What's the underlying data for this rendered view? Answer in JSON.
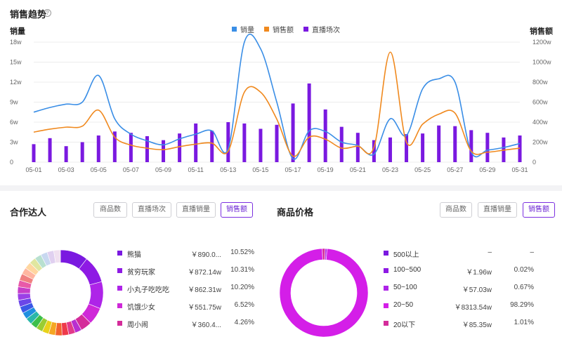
{
  "trend": {
    "title": "销售趋势",
    "help_icon": "?",
    "left_axis_title": "销量",
    "right_axis_title": "销售额",
    "legend": [
      {
        "name": "销量",
        "color": "#3a8ee6"
      },
      {
        "name": "销售额",
        "color": "#f0891e"
      },
      {
        "name": "直播场次",
        "color": "#7a19e0"
      }
    ]
  },
  "chart_data": {
    "type": "line",
    "x": [
      "05-01",
      "05-02",
      "05-03",
      "05-04",
      "05-05",
      "05-06",
      "05-07",
      "05-08",
      "05-09",
      "05-10",
      "05-11",
      "05-12",
      "05-13",
      "05-14",
      "05-15",
      "05-16",
      "05-17",
      "05-18",
      "05-19",
      "05-20",
      "05-21",
      "05-22",
      "05-23",
      "05-24",
      "05-25",
      "05-26",
      "05-27",
      "05-28",
      "05-29",
      "05-30",
      "05-31"
    ],
    "x_tick_labels": [
      "05-01",
      "05-03",
      "05-05",
      "05-07",
      "05-09",
      "05-11",
      "05-13",
      "05-15",
      "05-17",
      "05-19",
      "05-21",
      "05-23",
      "05-25",
      "05-27",
      "05-29",
      "05-31"
    ],
    "left_axis": {
      "ticks": [
        "0",
        "3w",
        "6w",
        "9w",
        "12w",
        "15w",
        "18w"
      ],
      "range": [
        0,
        18
      ]
    },
    "right_axis": {
      "ticks": [
        "0",
        "200w",
        "400w",
        "600w",
        "800w",
        "1000w",
        "1200w"
      ],
      "range": [
        0,
        1200
      ]
    },
    "series": [
      {
        "name": "销量",
        "axis": "left",
        "color": "#3a8ee6",
        "values": [
          7.5,
          8.2,
          8.7,
          9.0,
          13.0,
          6.5,
          4.2,
          3.2,
          2.6,
          3.5,
          4.2,
          4.7,
          2.0,
          18.0,
          17.0,
          9.0,
          0.5,
          4.7,
          4.6,
          3.0,
          2.5,
          1.2,
          6.5,
          4.0,
          11.0,
          12.5,
          12.0,
          1.5,
          1.8,
          2.2,
          2.8
        ]
      },
      {
        "name": "销售额",
        "axis": "right",
        "color": "#f0891e",
        "values": [
          300,
          330,
          350,
          360,
          520,
          250,
          170,
          140,
          125,
          155,
          180,
          190,
          110,
          700,
          700,
          430,
          60,
          250,
          230,
          140,
          160,
          150,
          1100,
          200,
          380,
          480,
          490,
          110,
          100,
          120,
          140
        ]
      },
      {
        "name": "直播场次",
        "axis": "left",
        "type": "bar",
        "color": "#7a19e0",
        "values": [
          2.7,
          3.6,
          2.4,
          3.0,
          4.0,
          4.6,
          4.4,
          3.9,
          3.3,
          4.3,
          5.8,
          4.7,
          6.0,
          5.8,
          5.0,
          5.6,
          8.8,
          11.8,
          7.9,
          5.3,
          4.4,
          3.3,
          3.7,
          4.2,
          4.3,
          5.5,
          5.4,
          4.8,
          4.4,
          3.7,
          4.0
        ]
      }
    ],
    "grid": true,
    "legend_position": "top-center"
  },
  "partners": {
    "title": "合作达人",
    "buttons": [
      {
        "label": "商品数",
        "active": false
      },
      {
        "label": "直播场次",
        "active": false
      },
      {
        "label": "直播销量",
        "active": false
      },
      {
        "label": "销售额",
        "active": true
      }
    ],
    "items": [
      {
        "name": "熊猫",
        "value": "￥890.0...",
        "pct": "10.52%",
        "color": "#7a19e0"
      },
      {
        "name": "贫穷玩家",
        "value": "￥872.14w",
        "pct": "10.31%",
        "color": "#8e1ae4"
      },
      {
        "name": "小丸子吃吃吃",
        "value": "￥862.31w",
        "pct": "10.20%",
        "color": "#ae24e8"
      },
      {
        "name": "饥饿少女",
        "value": "￥551.75w",
        "pct": "6.52%",
        "color": "#cf28d8"
      },
      {
        "name": "周小闹",
        "value": "￥360.4...",
        "pct": "4.26%",
        "color": "#d42c9a"
      }
    ]
  },
  "price": {
    "title": "商品价格",
    "buttons": [
      {
        "label": "商品数",
        "active": false
      },
      {
        "label": "直播销量",
        "active": false
      },
      {
        "label": "销售额",
        "active": true
      }
    ],
    "items": [
      {
        "name": "500以上",
        "value": "–",
        "pct": "–",
        "color": "#7a19e0",
        "share": 0
      },
      {
        "name": "100~500",
        "value": "￥1.96w",
        "pct": "0.02%",
        "color": "#8e1ae4",
        "share": 0.02
      },
      {
        "name": "50~100",
        "value": "￥57.03w",
        "pct": "0.67%",
        "color": "#ae24e8",
        "share": 0.67
      },
      {
        "name": "20~50",
        "value": "￥8313.54w",
        "pct": "98.29%",
        "color": "#d41ee8",
        "share": 98.29
      },
      {
        "name": "20以下",
        "value": "￥85.35w",
        "pct": "1.01%",
        "color": "#d42c9a",
        "share": 1.01
      }
    ]
  }
}
